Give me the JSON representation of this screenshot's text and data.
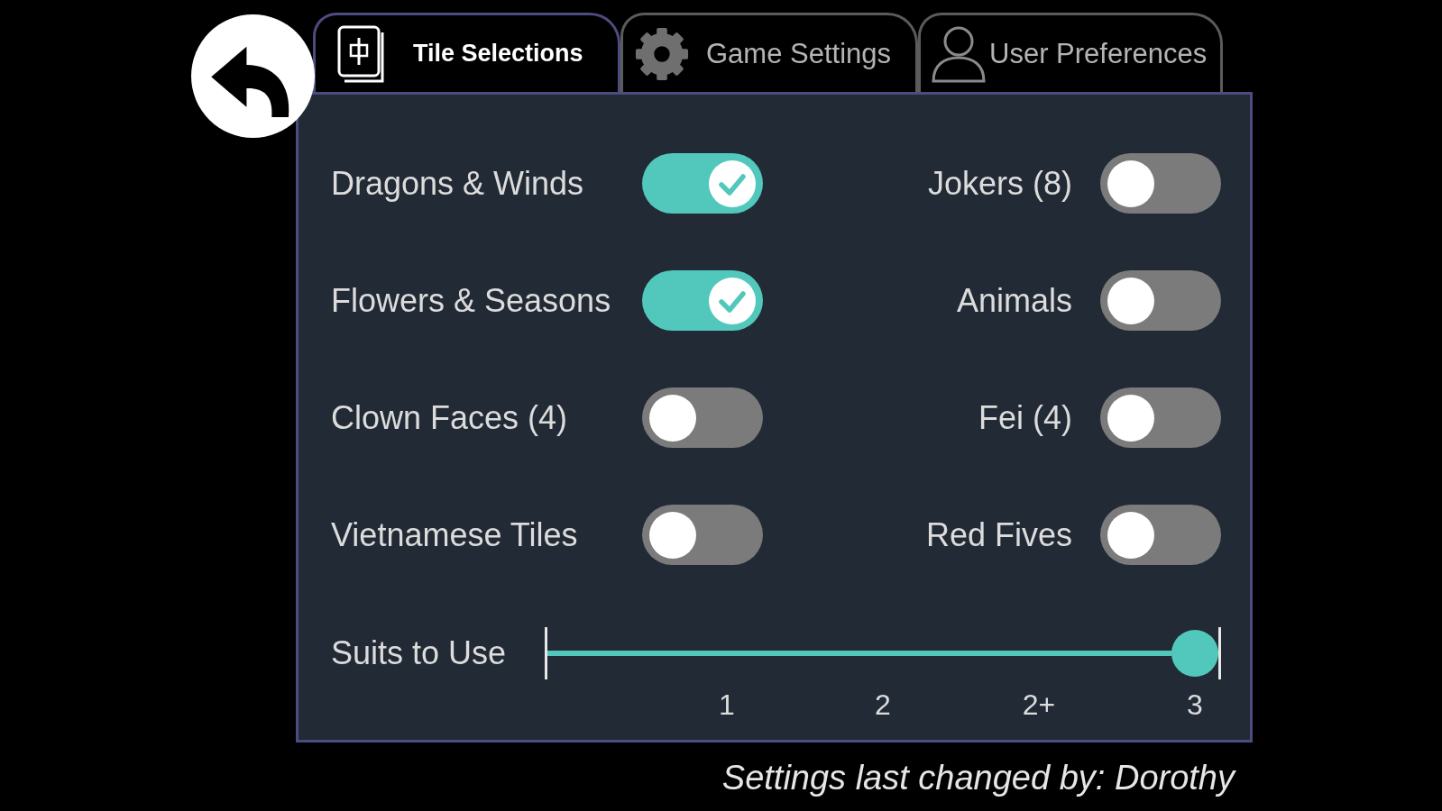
{
  "tabs": [
    {
      "label": "Tile Selections",
      "selected": true
    },
    {
      "label": "Game Settings",
      "selected": false
    },
    {
      "label": "User Preferences",
      "selected": false
    }
  ],
  "options": [
    {
      "label": "Dragons & Winds",
      "on": true
    },
    {
      "label": "Jokers (8)",
      "on": false
    },
    {
      "label": "Flowers & Seasons",
      "on": true
    },
    {
      "label": "Animals",
      "on": false
    },
    {
      "label": "Clown Faces (4)",
      "on": false
    },
    {
      "label": "Fei (4)",
      "on": false
    },
    {
      "label": "Vietnamese Tiles",
      "on": false
    },
    {
      "label": "Red Fives",
      "on": false
    }
  ],
  "slider": {
    "label": "Suits to Use",
    "level": 1,
    "ticks": [
      "1",
      "2",
      "2+",
      "3"
    ]
  },
  "status": "Settings last changed by: Dorothy"
}
